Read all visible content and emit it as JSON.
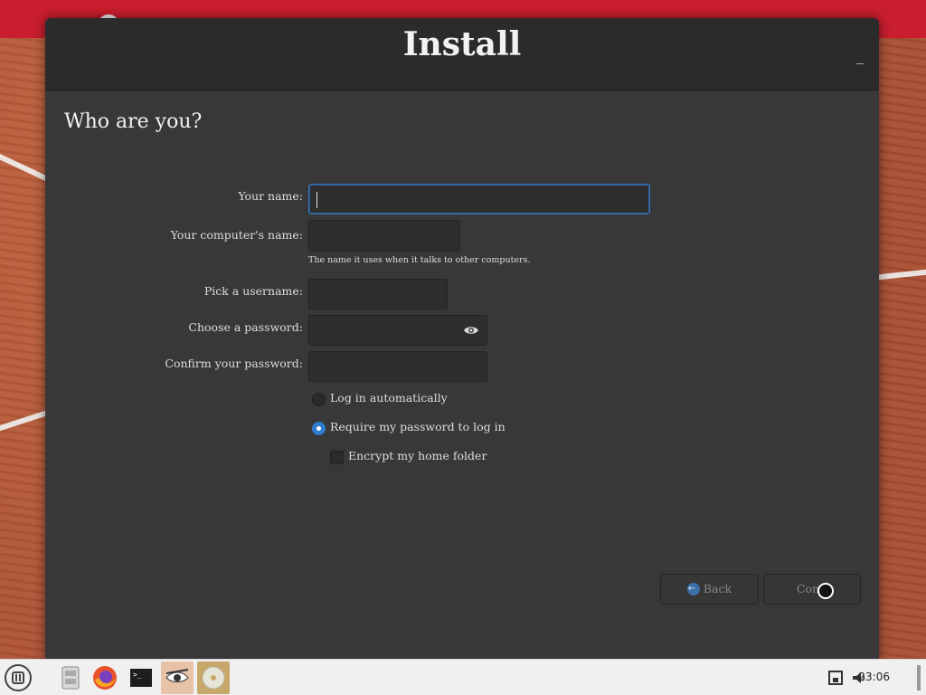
{
  "window": {
    "title": "Install"
  },
  "page": {
    "heading": "Who are you?"
  },
  "form": {
    "name_label": "Your name:",
    "name_value": "",
    "computer_label": "Your computer's name:",
    "computer_value": "",
    "computer_hint": "The name it uses when it talks to other computers.",
    "username_label": "Pick a username:",
    "username_value": "",
    "password_label": "Choose a password:",
    "password_value": "",
    "confirm_label": "Confirm your password:",
    "confirm_value": "",
    "login_auto_label": "Log in automatically",
    "login_auto_selected": false,
    "require_password_label": "Require my password to log in",
    "require_password_selected": true,
    "encrypt_label": "Encrypt my home folder",
    "encrypt_checked": false
  },
  "buttons": {
    "back_label": "Back",
    "continue_label": "Conti"
  },
  "taskbar": {
    "clock": "23:06",
    "apps": [
      "menu-icon",
      "file-manager-icon",
      "firefox-icon",
      "terminal-icon",
      "installer-icon",
      "disc-icon"
    ],
    "tray": [
      "network-icon",
      "volume-icon"
    ]
  },
  "colors": {
    "accent": "#2f7bd0",
    "window_bg": "#383838",
    "titlebar_bg": "#2b2b2b"
  }
}
